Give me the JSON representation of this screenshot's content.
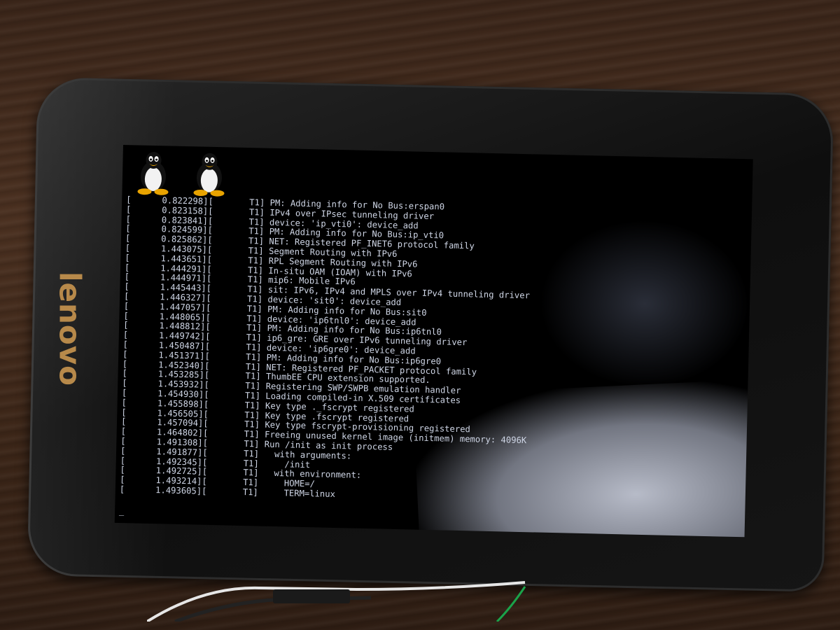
{
  "brand": "lenovo",
  "colors": {
    "terminal_text": "#cfd6e6",
    "screen_bg": "#000000",
    "brand": "#b7894a"
  },
  "boot_logo_count": 2,
  "cursor": "_",
  "log": [
    {
      "open": "[",
      "ts": "0.822298]",
      "mid": "[",
      "tag": "T1]",
      "msg": "PM: Adding info for No Bus:erspan0"
    },
    {
      "open": "[",
      "ts": "0.823158]",
      "mid": "[",
      "tag": "T1]",
      "msg": "IPv4 over IPsec tunneling driver"
    },
    {
      "open": "[",
      "ts": "0.823841]",
      "mid": "[",
      "tag": "T1]",
      "msg": "device: 'ip_vti0': device_add"
    },
    {
      "open": "[",
      "ts": "0.824599]",
      "mid": "[",
      "tag": "T1]",
      "msg": "PM: Adding info for No Bus:ip_vti0"
    },
    {
      "open": "[",
      "ts": "0.825862]",
      "mid": "[",
      "tag": "T1]",
      "msg": "NET: Registered PF_INET6 protocol family"
    },
    {
      "open": "[",
      "ts": "1.443075]",
      "mid": "[",
      "tag": "T1]",
      "msg": "Segment Routing with IPv6"
    },
    {
      "open": "[",
      "ts": "1.443651]",
      "mid": "[",
      "tag": "T1]",
      "msg": "RPL Segment Routing with IPv6"
    },
    {
      "open": "[",
      "ts": "1.444291]",
      "mid": "[",
      "tag": "T1]",
      "msg": "In-situ OAM (IOAM) with IPv6"
    },
    {
      "open": "[",
      "ts": "1.444971]",
      "mid": "[",
      "tag": "T1]",
      "msg": "mip6: Mobile IPv6"
    },
    {
      "open": "[",
      "ts": "1.445443]",
      "mid": "[",
      "tag": "T1]",
      "msg": "sit: IPv6, IPv4 and MPLS over IPv4 tunneling driver"
    },
    {
      "open": "[",
      "ts": "1.446327]",
      "mid": "[",
      "tag": "T1]",
      "msg": "device: 'sit0': device_add"
    },
    {
      "open": "[",
      "ts": "1.447057]",
      "mid": "[",
      "tag": "T1]",
      "msg": "PM: Adding info for No Bus:sit0"
    },
    {
      "open": "[",
      "ts": "1.448065]",
      "mid": "[",
      "tag": "T1]",
      "msg": "device: 'ip6tnl0': device_add"
    },
    {
      "open": "[",
      "ts": "1.448812]",
      "mid": "[",
      "tag": "T1]",
      "msg": "PM: Adding info for No Bus:ip6tnl0"
    },
    {
      "open": "[",
      "ts": "1.449742]",
      "mid": "[",
      "tag": "T1]",
      "msg": "ip6_gre: GRE over IPv6 tunneling driver"
    },
    {
      "open": "[",
      "ts": "1.450487]",
      "mid": "[",
      "tag": "T1]",
      "msg": "device: 'ip6gre0': device_add"
    },
    {
      "open": "[",
      "ts": "1.451371]",
      "mid": "[",
      "tag": "T1]",
      "msg": "PM: Adding info for No Bus:ip6gre0"
    },
    {
      "open": "[",
      "ts": "1.452340]",
      "mid": "[",
      "tag": "T1]",
      "msg": "NET: Registered PF_PACKET protocol family"
    },
    {
      "open": "[",
      "ts": "1.453285]",
      "mid": "[",
      "tag": "T1]",
      "msg": "ThumbEE CPU extension supported."
    },
    {
      "open": "[",
      "ts": "1.453932]",
      "mid": "[",
      "tag": "T1]",
      "msg": "Registering SWP/SWPB emulation handler"
    },
    {
      "open": "[",
      "ts": "1.454930]",
      "mid": "[",
      "tag": "T1]",
      "msg": "Loading compiled-in X.509 certificates"
    },
    {
      "open": "[",
      "ts": "1.455898]",
      "mid": "[",
      "tag": "T1]",
      "msg": "Key type ._fscrypt registered"
    },
    {
      "open": "[",
      "ts": "1.456505]",
      "mid": "[",
      "tag": "T1]",
      "msg": "Key type .fscrypt registered"
    },
    {
      "open": "[",
      "ts": "1.457094]",
      "mid": "[",
      "tag": "T1]",
      "msg": "Key type fscrypt-provisioning registered"
    },
    {
      "open": "[",
      "ts": "1.464802]",
      "mid": "[",
      "tag": "T1]",
      "msg": "Freeing unused kernel image (initmem) memory: 4096K"
    },
    {
      "open": "[",
      "ts": "1.491308]",
      "mid": "[",
      "tag": "T1]",
      "msg": "Run /init as init process"
    },
    {
      "open": "[",
      "ts": "1.491877]",
      "mid": "[",
      "tag": "T1]",
      "msg": "  with arguments:"
    },
    {
      "open": "[",
      "ts": "1.492345]",
      "mid": "[",
      "tag": "T1]",
      "msg": "    /init"
    },
    {
      "open": "[",
      "ts": "1.492725]",
      "mid": "[",
      "tag": "T1]",
      "msg": "  with environment:"
    },
    {
      "open": "[",
      "ts": "1.493214]",
      "mid": "[",
      "tag": "T1]",
      "msg": "    HOME=/"
    },
    {
      "open": "[",
      "ts": "1.493605]",
      "mid": "[",
      "tag": "T1]",
      "msg": "    TERM=linux"
    }
  ]
}
